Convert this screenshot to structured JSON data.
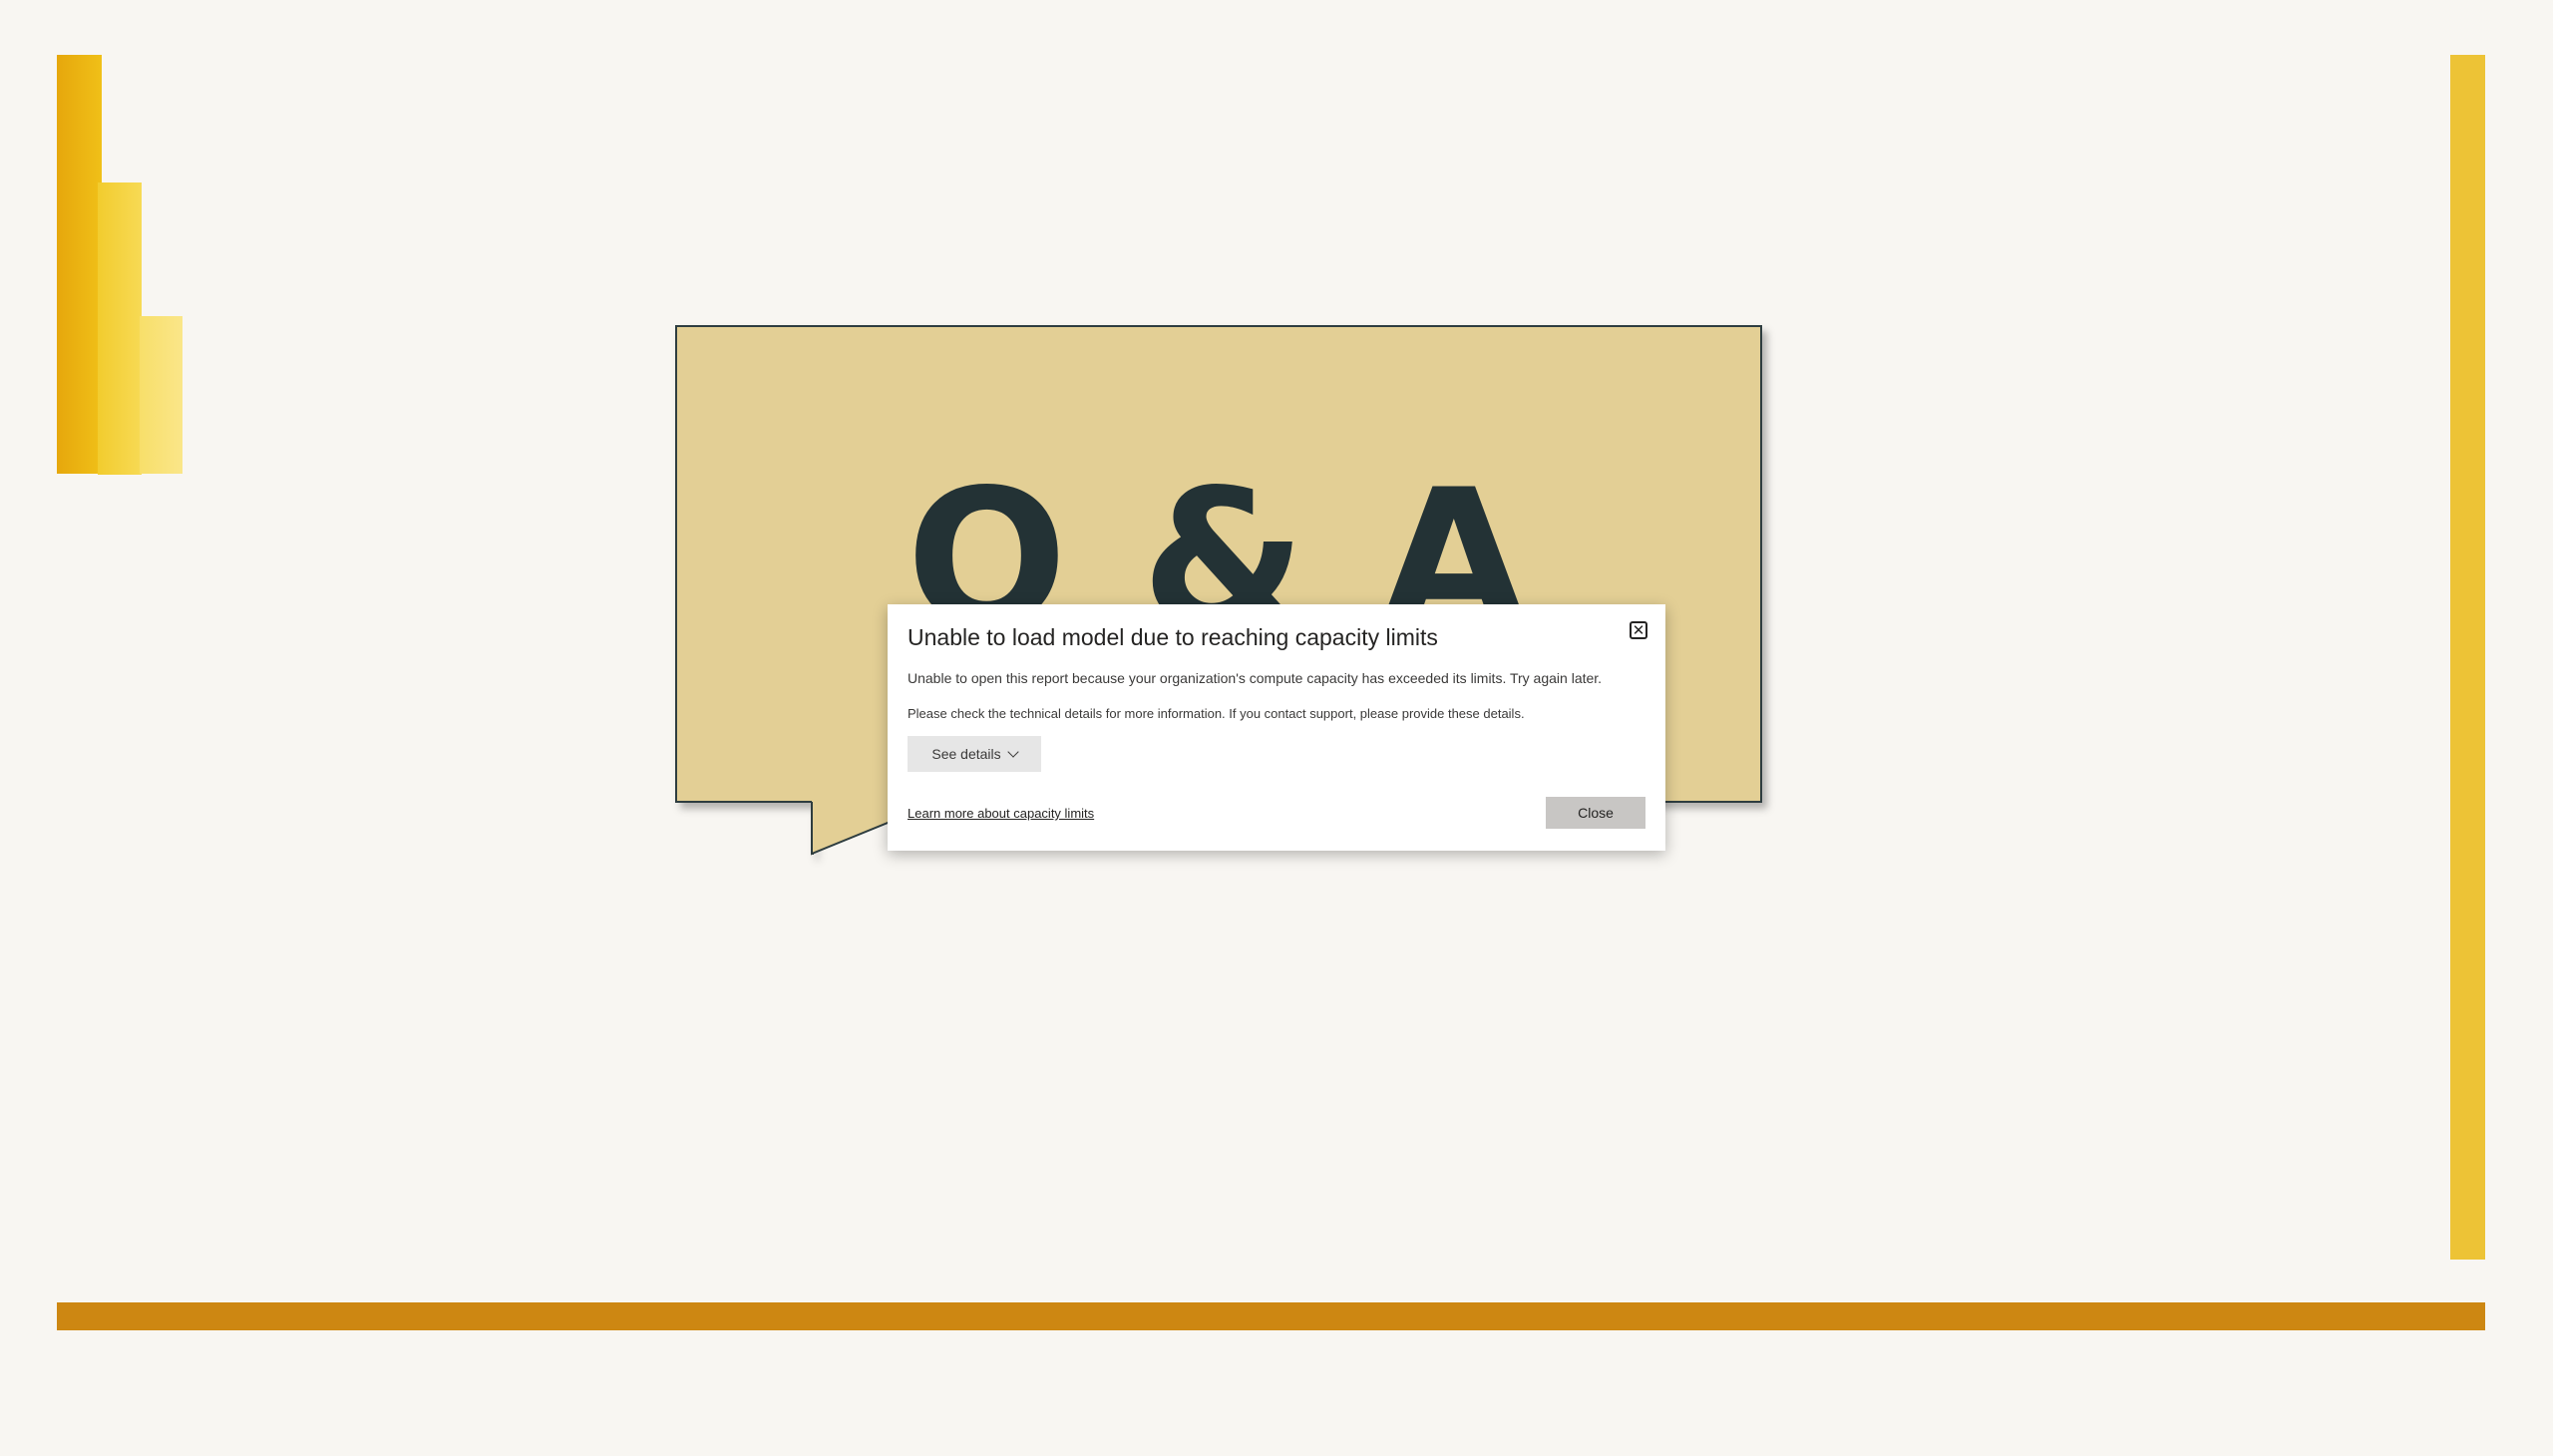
{
  "bubble": {
    "text": "Q & A",
    "fill_color": "#e3cf95",
    "border_color": "#2e3d3f",
    "text_color": "#233235"
  },
  "dialog": {
    "title": "Unable to load model due to reaching capacity limits",
    "message": "Unable to open this report because your organization's compute capacity has exceeded its limits. Try again later.",
    "details_note": "Please check the technical details for more information. If you contact support, please provide these details.",
    "see_details_label": "See details",
    "learn_more_label": "Learn more about capacity limits",
    "close_label": "Close",
    "dismiss_icon": "close-icon"
  },
  "colors": {
    "background": "#f8f6f2",
    "accent_yellow": "#edc336",
    "accent_orange": "#cd8712"
  },
  "icons": {
    "logo": "power-bi-logo-icon",
    "dismiss": "close-icon",
    "expand": "chevron-down-icon"
  }
}
